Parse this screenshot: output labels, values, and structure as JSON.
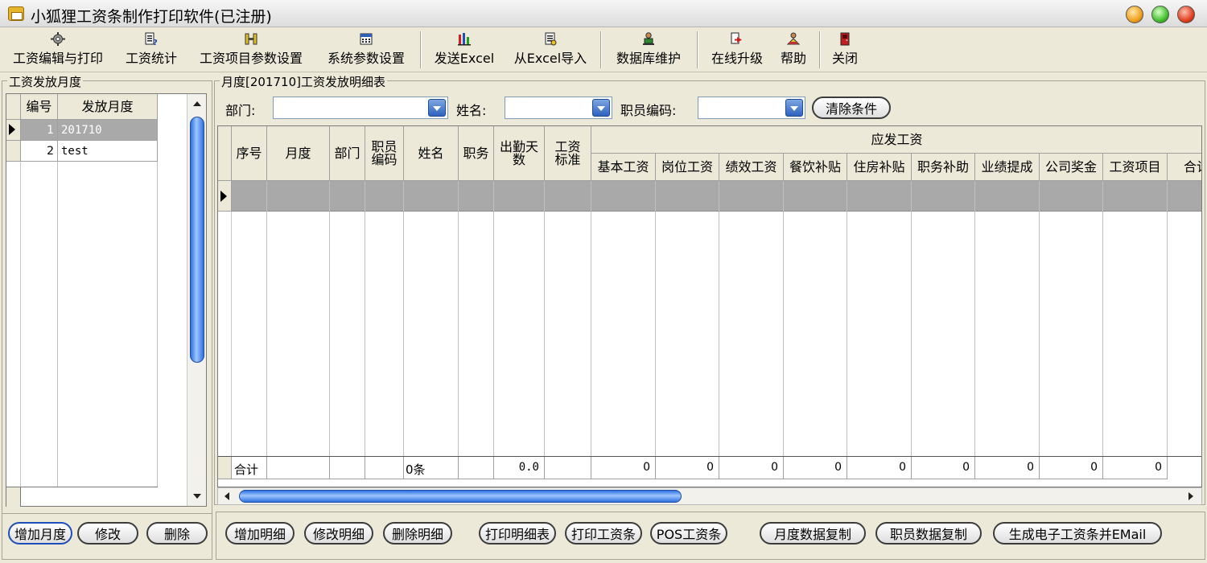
{
  "window": {
    "title": "小狐狸工资条制作打印软件(已注册)"
  },
  "toolbar": {
    "items": [
      {
        "label": "工资编辑与打印",
        "icon": "gear-icon"
      },
      {
        "label": "工资统计",
        "icon": "report-icon"
      },
      {
        "label": "工资项目参数设置",
        "icon": "settings-icon"
      },
      {
        "label": "系统参数设置",
        "icon": "calculator-icon"
      },
      {
        "label": "发送Excel",
        "icon": "excel-export-icon"
      },
      {
        "label": "从Excel导入",
        "icon": "excel-import-icon"
      },
      {
        "label": "数据库维护",
        "icon": "database-user-icon"
      },
      {
        "label": "在线升级",
        "icon": "upgrade-icon"
      },
      {
        "label": "帮助",
        "icon": "help-icon"
      },
      {
        "label": "关闭",
        "icon": "exit-door-icon"
      }
    ]
  },
  "left_panel": {
    "title": "工资发放月度",
    "columns": [
      "编号",
      "发放月度"
    ],
    "rows": [
      {
        "no": "1",
        "month": "201710"
      },
      {
        "no": "2",
        "month": "test"
      }
    ],
    "buttons": [
      "增加月度",
      "修改",
      "删除"
    ]
  },
  "right_panel": {
    "title": "月度[201710]工资发放明细表",
    "filters": {
      "dept_label": "部门:",
      "name_label": "姓名:",
      "code_label": "职员编码:",
      "dept_value": "",
      "name_value": "",
      "code_value": "",
      "clear_button": "清除条件"
    },
    "table": {
      "group_header": "应发工资",
      "columns": [
        "序号",
        "月度",
        "部门",
        "职员编码",
        "姓名",
        "职务",
        "出勤天数",
        "工资标准",
        "基本工资",
        "岗位工资",
        "绩效工资",
        "餐饮补贴",
        "住房补贴",
        "职务补助",
        "业绩提成",
        "公司奖金",
        "工资项目",
        "合计"
      ],
      "totals": {
        "label": "合计",
        "count": "0条",
        "days": "0.0",
        "values": [
          "0",
          "0",
          "0",
          "0",
          "0",
          "0",
          "0",
          "0",
          "0"
        ]
      }
    },
    "buttons": [
      "增加明细",
      "修改明细",
      "删除明细",
      "打印明细表",
      "打印工资条",
      "POS工资条",
      "月度数据复制",
      "职员数据复制",
      "生成电子工资条并EMail"
    ]
  }
}
